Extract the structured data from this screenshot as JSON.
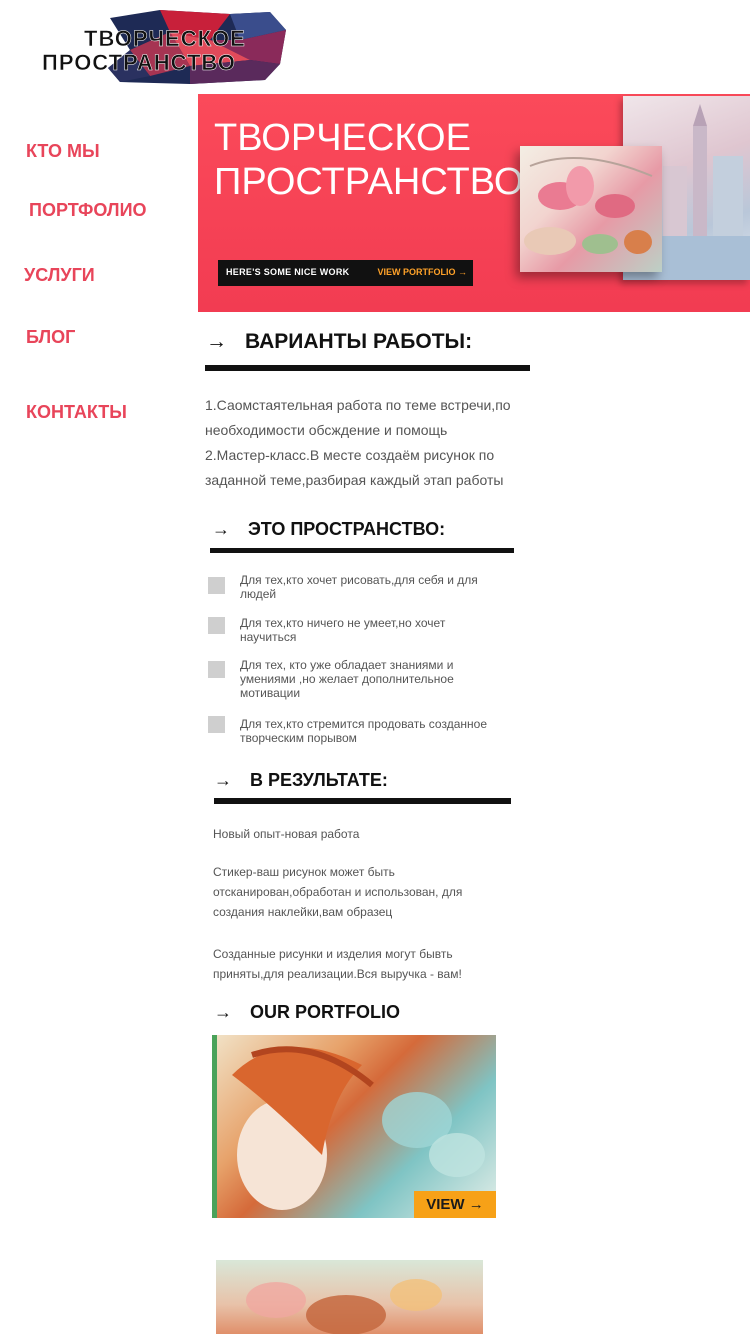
{
  "logo": {
    "line1": "ТВОРЧЕСКОЕ",
    "line2": "ПРОСТРАНСТВО"
  },
  "nav": {
    "items": [
      {
        "label": "КТО МЫ"
      },
      {
        "label": "ПОРТФОЛИО"
      },
      {
        "label": "УСЛУГИ"
      },
      {
        "label": "БЛОГ"
      },
      {
        "label": "КОНТАКТЫ"
      }
    ]
  },
  "hero": {
    "title_line1": "ТВОРЧЕСКОЕ",
    "title_line2": "ПРОСТРАНСТВО",
    "bar_text": "HERE'S SOME NICE WORK",
    "bar_link": "VIEW PORTFOLIO →"
  },
  "sections": {
    "variants": {
      "arrow": "→",
      "title": "ВАРИАНТЫ РАБОТЫ:",
      "lines": [
        "1.Саомстаятельная работа по теме встречи,по",
        "необходимости обсждение и помощь",
        "2.Мастер-класс.В месте создаём рисунок по",
        "заданной теме,разбирая каждый этап работы"
      ]
    },
    "space": {
      "arrow": "→",
      "title": "ЭТО ПРОСТРАНСТВО:",
      "items": [
        {
          "line1": "Для тех,кто хочет рисовать,для себя и для",
          "line2": "людей",
          "line3": ""
        },
        {
          "line1": "Для тех,кто ничего не умеет,но хочет",
          "line2": "научиться",
          "line3": ""
        },
        {
          "line1": "Для тех, кто уже обладает знаниями и",
          "line2": "умениями ,но желает дополнительное",
          "line3": "мотивации"
        },
        {
          "line1": "Для тех,кто стремится продовать созданное",
          "line2": "творческим порывом",
          "line3": ""
        }
      ]
    },
    "result": {
      "arrow": "→",
      "title": "В РЕЗУЛЬТАТЕ:",
      "p1": "Новый опыт-новая работа",
      "p2_l1": "Стикер-ваш рисунок может быть",
      "p2_l2": "отсканирован,обработан и использован, для",
      "p2_l3": "создания наклейки,вам образец",
      "p3_l1": "Созданные рисунки и изделия могут бывть",
      "p3_l2": "приняты,для реализации.Вся выручка - вам!"
    },
    "portfolio": {
      "arrow": "→",
      "title": "OUR PORTFOLIO",
      "view_label": "VIEW →"
    }
  },
  "colors": {
    "accent": "#e8455a",
    "hero_bg": "#f64257",
    "view_btn": "#f7a117"
  }
}
